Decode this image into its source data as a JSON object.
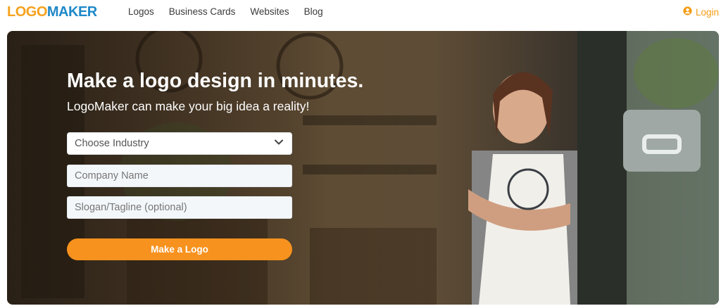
{
  "brand": {
    "logo_part1": "LOGO",
    "logo_part2": "MAKER"
  },
  "nav": {
    "items": [
      "Logos",
      "Business Cards",
      "Websites",
      "Blog"
    ],
    "login_label": "Login"
  },
  "hero": {
    "title": "Make a logo design in minutes.",
    "subtitle": "LogoMaker can make your big idea a reality!",
    "industry_select": {
      "value": "Choose Industry"
    },
    "company_input": {
      "placeholder": "Company Name"
    },
    "slogan_input": {
      "placeholder": "Slogan/Tagline (optional)"
    },
    "cta_label": "Make a Logo"
  },
  "colors": {
    "accent": "#f7921e",
    "logo_orange": "#f5a21d",
    "logo_blue": "#1e88c8"
  }
}
